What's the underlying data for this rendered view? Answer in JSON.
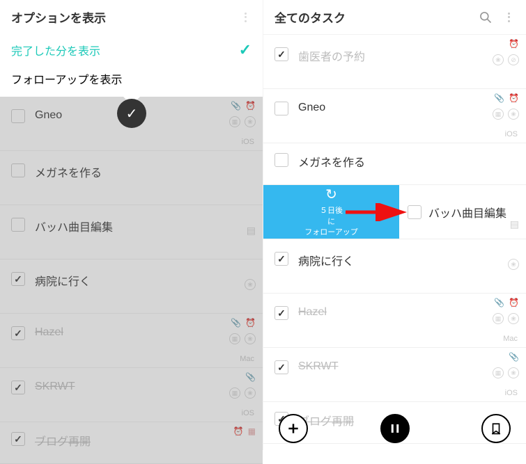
{
  "left": {
    "options_title": "オプションを表示",
    "opt_show_completed": "完了した分を表示",
    "opt_show_followup": "フォローアップを表示"
  },
  "right": {
    "header_title": "全てのタスク"
  },
  "swipe": {
    "line1": "５日後",
    "line2": "に",
    "line3": "フォローアップ"
  },
  "tags": {
    "ios": "iOS",
    "mac": "Mac"
  },
  "tasks": {
    "t0": {
      "label": "歯医者の予約"
    },
    "t1": {
      "label": "Gneo"
    },
    "t2": {
      "label": "メガネを作る"
    },
    "t3": {
      "label": "バッハ曲目編集"
    },
    "t4": {
      "label": "病院に行く"
    },
    "t5": {
      "label": "Hazel"
    },
    "t6": {
      "label": "SKRWT"
    },
    "t7": {
      "label": "ブログ再開"
    }
  }
}
